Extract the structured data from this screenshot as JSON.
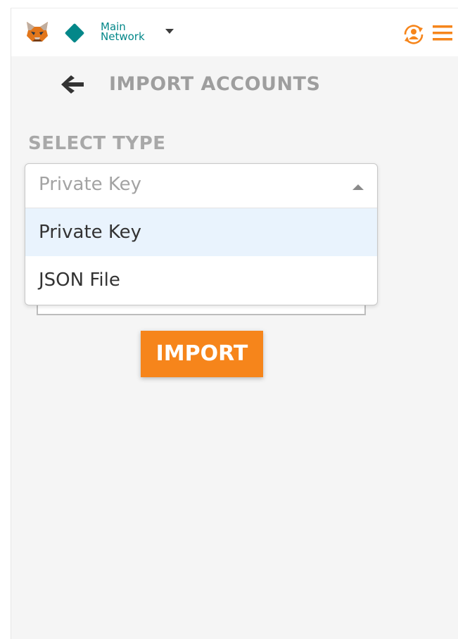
{
  "network": {
    "name_line1": "Main",
    "name_line2": "Network"
  },
  "header": {
    "title": "IMPORT ACCOUNTS"
  },
  "select_type": {
    "label": "SELECT TYPE",
    "selected_value": "Private Key",
    "options": [
      {
        "label": "Private Key",
        "highlighted": true
      },
      {
        "label": "JSON File",
        "highlighted": false
      }
    ]
  },
  "actions": {
    "import_label": "IMPORT"
  },
  "icons": {
    "logo": "metamask-fox-icon",
    "network_indicator": "diamond-icon",
    "network_dropdown": "caret-down-icon",
    "account": "account-switch-icon",
    "menu": "hamburger-menu-icon",
    "back": "back-arrow-icon",
    "select_toggle": "caret-up-icon"
  },
  "colors": {
    "accent": "#f6851b",
    "network": "#038789",
    "highlight_option": "#e9f3fd"
  }
}
